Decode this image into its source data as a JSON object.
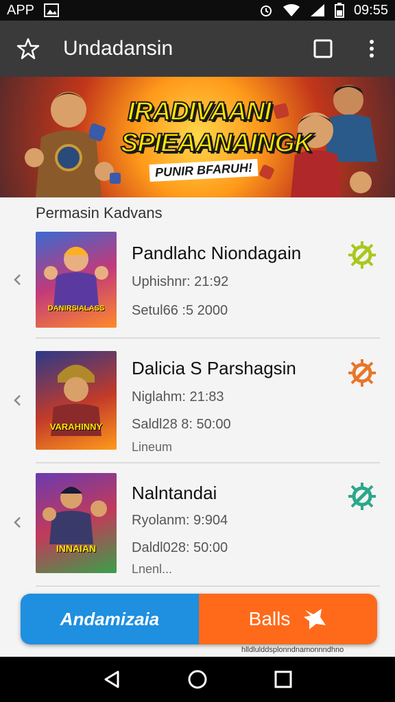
{
  "status_bar": {
    "app_label": "APP",
    "time": "09:55"
  },
  "app_bar": {
    "title": "Undadansin"
  },
  "banner": {
    "title_line1": "IRADIVAANI",
    "title_line2": "SPIEAANAINGK",
    "subtitle": "PUNIR BFARUH!"
  },
  "section": {
    "header": "Permasin Kadvans"
  },
  "items": [
    {
      "title": "Pandlahc Niondagain",
      "line1": "Uphishnr: 21:92",
      "line2": "Setul66 :5 2000",
      "extra": "",
      "icon_color": "#a8c81e",
      "thumb_label": "DANIRSIALASS"
    },
    {
      "title": "Dalicia S Parshagsin",
      "line1": "Niglahm: 21:83",
      "line2": "Saldl28 8: 50:00",
      "extra": "Lineum",
      "icon_color": "#e8762a",
      "thumb_label": "VARAHINNY"
    },
    {
      "title": "Nalntandai",
      "line1": "Ryolanm: 9:904",
      "line2": "Daldl028: 50:00",
      "extra": "Lnenl...",
      "icon_color": "#2aa88a",
      "thumb_label": "INNAIAN"
    }
  ],
  "bottom_bar": {
    "left_label": "Andamizaia",
    "right_label": "Balls"
  },
  "footer_note": "hlldlulddsplonndnamonnndhno"
}
